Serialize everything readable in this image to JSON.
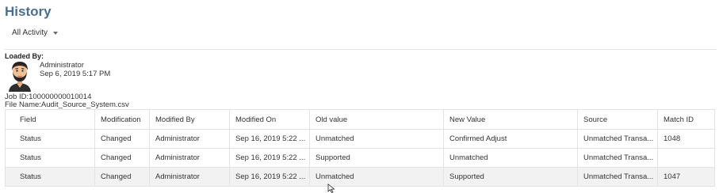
{
  "page": {
    "title": "History",
    "activity_filter": "All Activity"
  },
  "loaded_by": {
    "label": "Loaded By:",
    "name": "Administrator",
    "date": "Sep 6, 2019 5:17 PM"
  },
  "job": {
    "id_text": "Job ID:100000000010014",
    "file_text": "File Name:Audit_Source_System.csv"
  },
  "table": {
    "columns": [
      "Field",
      "Modification",
      "Modified By",
      "Modified On",
      "Old value",
      "New Value",
      "Source",
      "Match ID"
    ],
    "rows": [
      [
        "Status",
        "Changed",
        "Administrator",
        "Sep 16, 2019 5:22 ...",
        "Unmatched",
        "Confirmed Adjust",
        "Unmatched Transa...",
        "1048"
      ],
      [
        "Status",
        "Changed",
        "Administrator",
        "Sep 16, 2019 5:22 ...",
        "Supported",
        "Unmatched",
        "Unmatched Transa...",
        ""
      ],
      [
        "Status",
        "Changed",
        "Administrator",
        "Sep 16, 2019 5:22 ...",
        "Unmatched",
        "Supported",
        "Unmatched Transa...",
        "1047"
      ]
    ]
  },
  "icons": {
    "avatar": "user-avatar-icon",
    "dropdown": "chevron-down-icon",
    "cursor": "text-cursor-icon"
  },
  "colors": {
    "title": "#4a6e8c",
    "border": "#e3e3e3",
    "highlight_row": "#f2f2f2"
  }
}
